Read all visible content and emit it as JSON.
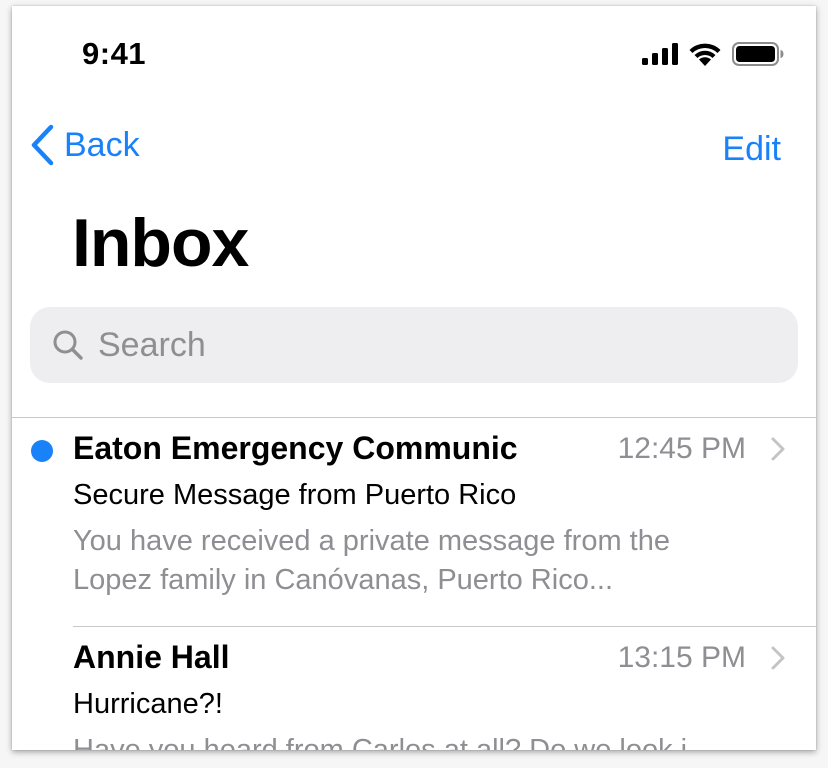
{
  "status_bar": {
    "time": "9:41",
    "icons": [
      "cellular-signal-icon",
      "wifi-icon",
      "battery-icon"
    ]
  },
  "nav": {
    "back_label": "Back",
    "edit_label": "Edit",
    "title": "Inbox"
  },
  "search": {
    "placeholder": "Search"
  },
  "colors": {
    "accent": "#1a82f8",
    "secondary_text": "#8e8e93",
    "search_bg": "#eeeef0"
  },
  "messages": [
    {
      "unread": true,
      "sender": "Eaton Emergency Communic",
      "time": "12:45 PM",
      "subject": "Secure Message from Puerto Rico",
      "preview_line1": "You have received a private message from the",
      "preview_line2": "Lopez family in Canóvanas, Puerto Rico..."
    },
    {
      "unread": false,
      "sender": "Annie Hall",
      "time": "13:15 PM",
      "subject": "Hurricane?!",
      "preview_line1": "Have you heard from Carlos at all? Do we look i",
      "preview_line2": ""
    }
  ]
}
